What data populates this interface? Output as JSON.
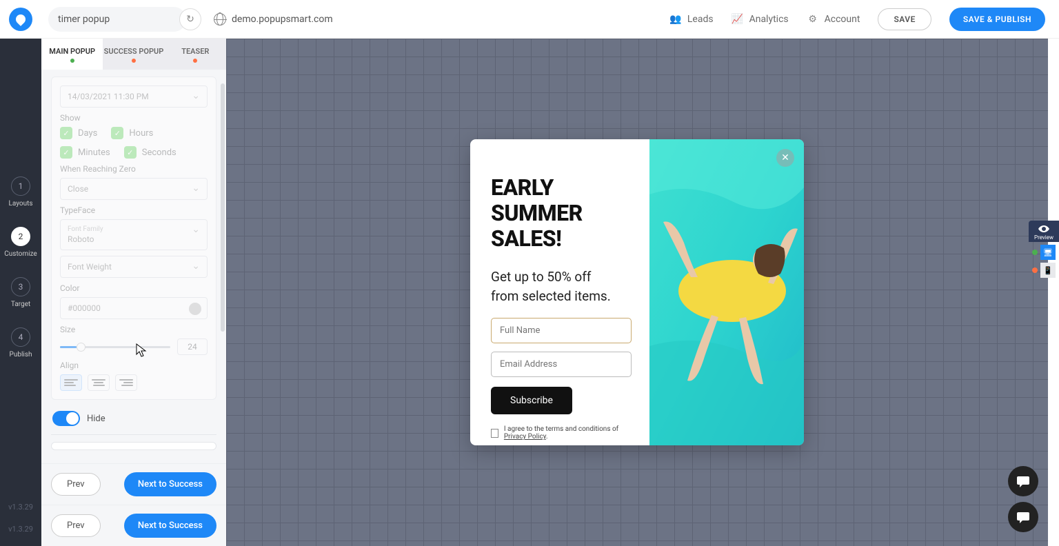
{
  "header": {
    "title_value": "timer popup",
    "domain": "demo.popupsmart.com",
    "links": {
      "leads": "Leads",
      "analytics": "Analytics",
      "account": "Account"
    },
    "save": "SAVE",
    "publish": "SAVE & PUBLISH"
  },
  "leftnav": {
    "steps": [
      {
        "num": "1",
        "label": "Layouts"
      },
      {
        "num": "2",
        "label": "Customize"
      },
      {
        "num": "3",
        "label": "Target"
      },
      {
        "num": "4",
        "label": "Publish"
      }
    ],
    "version": "v1.3.29"
  },
  "tabs": {
    "main": "MAIN POPUP",
    "success": "SUCCESS POPUP",
    "teaser": "TEASER"
  },
  "panel": {
    "date_value": "14/03/2021 11:30 PM",
    "show": {
      "label": "Show",
      "days": "Days",
      "hours": "Hours",
      "minutes": "Minutes",
      "seconds": "Seconds"
    },
    "reaching_zero": {
      "label": "When Reaching Zero",
      "value": "Close"
    },
    "typeface": {
      "label": "TypeFace",
      "family_label": "Font Family",
      "family_value": "Roboto",
      "weight_label": "Font Weight"
    },
    "color": {
      "label": "Color",
      "value": "#000000"
    },
    "size": {
      "label": "Size",
      "value": "24"
    },
    "align": {
      "label": "Align"
    },
    "hide": "Hide",
    "prev": "Prev",
    "next": "Next to Success"
  },
  "popup": {
    "title_l1": "EARLY",
    "title_l2": "SUMMER",
    "title_l3": "SALES!",
    "sub_l1": "Get up to 50% off",
    "sub_l2": "from selected items.",
    "name_placeholder": "Full Name",
    "email_placeholder": "Email Address",
    "subscribe": "Subscribe",
    "consent_pre": "I agree to the terms and conditions of ",
    "consent_link": "Privacy Policy"
  },
  "preview": {
    "label": "Preview"
  }
}
